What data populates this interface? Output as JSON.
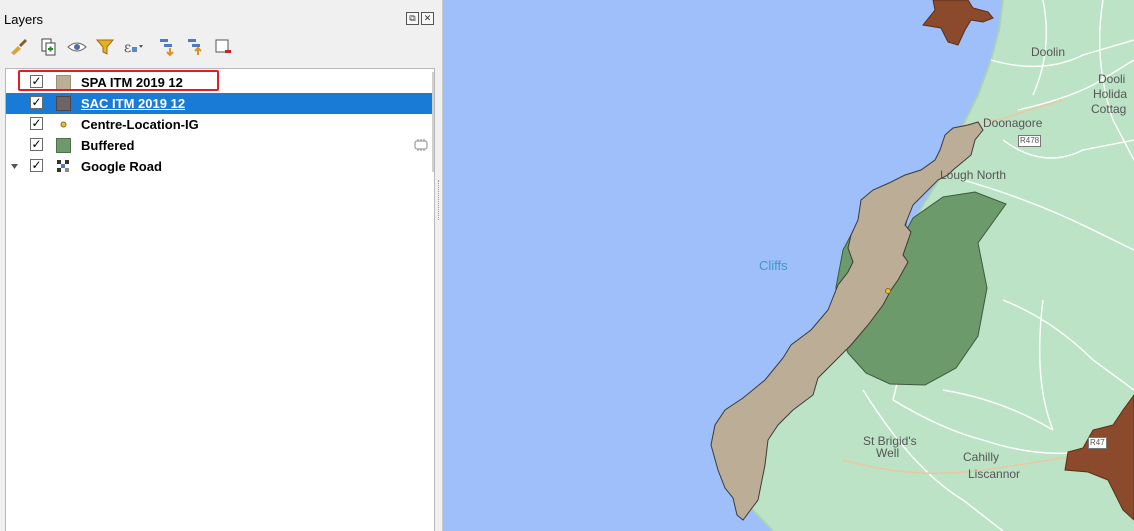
{
  "panel": {
    "title": "Layers",
    "float_icon": "float-icon",
    "close_icon": "close-icon"
  },
  "toolbar": [
    {
      "name": "style-manager-icon"
    },
    {
      "name": "add-group-icon"
    },
    {
      "name": "visibility-icon"
    },
    {
      "name": "filter-icon"
    },
    {
      "name": "filter-expression-icon"
    },
    {
      "name": "expand-all-icon"
    },
    {
      "name": "collapse-all-icon"
    },
    {
      "name": "remove-layer-icon"
    }
  ],
  "layers": [
    {
      "label": "SPA ITM 2019 12",
      "checked": true,
      "swatch": "#bcae96",
      "selected": false
    },
    {
      "label": "SAC ITM 2019 12",
      "checked": true,
      "swatch": "#6e6464",
      "selected": true
    },
    {
      "label": "Centre-Location-IG",
      "checked": true,
      "swatch": "point",
      "selected": false
    },
    {
      "label": "Buffered",
      "checked": true,
      "swatch": "#6d9a6b",
      "selected": false
    },
    {
      "label": "Google Road",
      "checked": true,
      "swatch": "raster",
      "selected": false
    }
  ],
  "map_labels": {
    "doolin": "Doolin",
    "doolin_holiday_1": "Dooli",
    "doolin_holiday_2": "Holida",
    "doolin_holiday_3": "Cottag",
    "doonagore": "Doonagore",
    "r478_top": "R478",
    "lough_north": "Lough North",
    "cliffs": "Cliffs",
    "st_brigids_1": "St Brigid's",
    "st_brigids_2": "Well",
    "cahilly": "Cahilly",
    "liscannor": "Liscannor",
    "r478_bottom": "R47"
  },
  "colors": {
    "sea": "#9ebffa",
    "land": "#bde3c6",
    "spa": "#bcae96",
    "sac": "#8b4a2b",
    "buffer": "#6d9a6b",
    "selection": "#1a7bd7"
  }
}
